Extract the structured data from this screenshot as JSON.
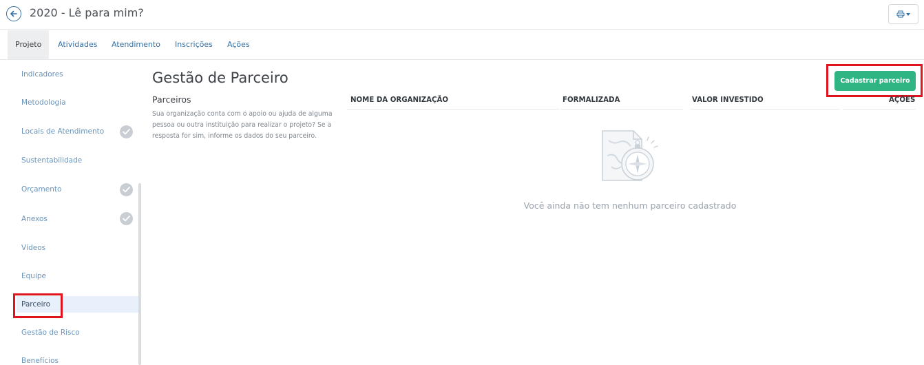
{
  "header": {
    "title": "2020 - Lê para mim?"
  },
  "tabs": [
    {
      "label": "Projeto"
    },
    {
      "label": "Atividades"
    },
    {
      "label": "Atendimento"
    },
    {
      "label": "Inscrições"
    },
    {
      "label": "Ações"
    }
  ],
  "sidebar": {
    "items": [
      {
        "label": "Indicadores",
        "completed": false
      },
      {
        "label": "Metodologia",
        "completed": false
      },
      {
        "label": "Locais de Atendimento",
        "completed": true
      },
      {
        "label": "Sustentabilidade",
        "completed": false
      },
      {
        "label": "Orçamento",
        "completed": true
      },
      {
        "label": "Anexos",
        "completed": true
      },
      {
        "label": "Vídeos",
        "completed": false
      },
      {
        "label": "Equipe",
        "completed": false
      },
      {
        "label": "Parceiro",
        "completed": false,
        "active": true
      },
      {
        "label": "Gestão de Risco",
        "completed": false
      },
      {
        "label": "Benefícios",
        "completed": false
      }
    ]
  },
  "main": {
    "title": "Gestão de Parceiro",
    "subtitle": "Parceiros",
    "description": "Sua organização conta com o apoio ou ajuda de alguma pessoa ou outra instituição para realizar o projeto? Se a resposta for sim, informe os dados do seu parceiro.",
    "add_button": "Cadastrar parceiro",
    "table": {
      "columns": [
        "NOME DA ORGANIZAÇÃO",
        "FORMALIZADA",
        "VALOR INVESTIDO",
        "AÇÕES"
      ]
    },
    "empty_message": "Você ainda não tem nenhum parceiro cadastrado"
  },
  "colors": {
    "accent": "#2f6ea5",
    "primary_button": "#2fb483",
    "highlight": "#e0141e"
  },
  "icons": {
    "back": "arrow-left-icon",
    "print": "printer-icon",
    "check": "check-icon",
    "empty": "map-compass-icon"
  }
}
